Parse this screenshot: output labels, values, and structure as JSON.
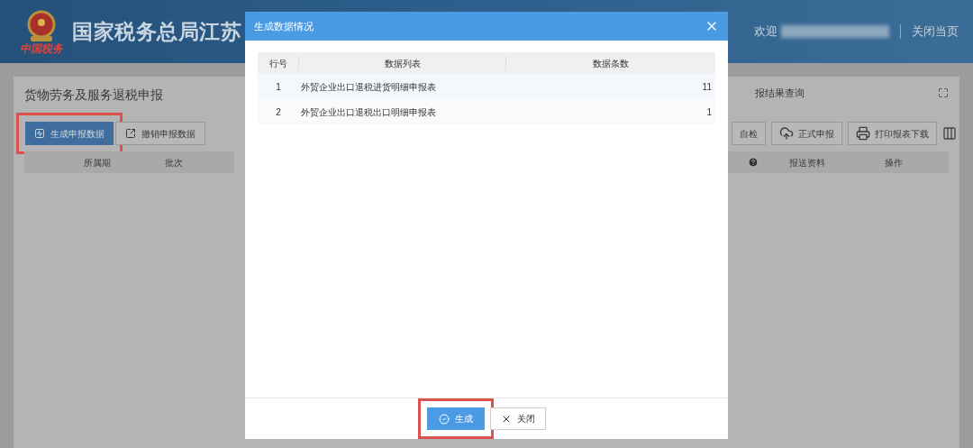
{
  "header": {
    "logo_text": "中国税务",
    "title": "国家税务总局江苏",
    "welcome": "欢迎",
    "close_page": "关闭当页"
  },
  "panel": {
    "title": "货物劳务及服务退税申报",
    "right_title": "报结果查询",
    "left_buttons": [
      {
        "label": "生成申报数据",
        "kind": "primary",
        "highlighted": true
      },
      {
        "label": "撤销申报数据",
        "kind": "default",
        "highlighted": false
      }
    ],
    "right_buttons": [
      {
        "label": "自检"
      },
      {
        "label": "正式申报"
      },
      {
        "label": "打印报表下载"
      }
    ],
    "left_columns": [
      "所属期",
      "批次"
    ],
    "right_columns": [
      {
        "kind": "help"
      },
      {
        "kind": "text",
        "label": "报送资料"
      },
      {
        "kind": "text",
        "label": "操作"
      }
    ]
  },
  "modal": {
    "title": "生成数据情况",
    "columns": [
      "行号",
      "数据列表",
      "数据条数"
    ],
    "rows": [
      {
        "no": "1",
        "name": "外贸企业出口退税进货明细申报表",
        "count": "11"
      },
      {
        "no": "2",
        "name": "外贸企业出口退税出口明细申报表",
        "count": "1"
      }
    ],
    "buttons": [
      {
        "label": "生成",
        "kind": "primary",
        "highlighted": true
      },
      {
        "label": "关闭",
        "kind": "close",
        "highlighted": false
      }
    ]
  }
}
